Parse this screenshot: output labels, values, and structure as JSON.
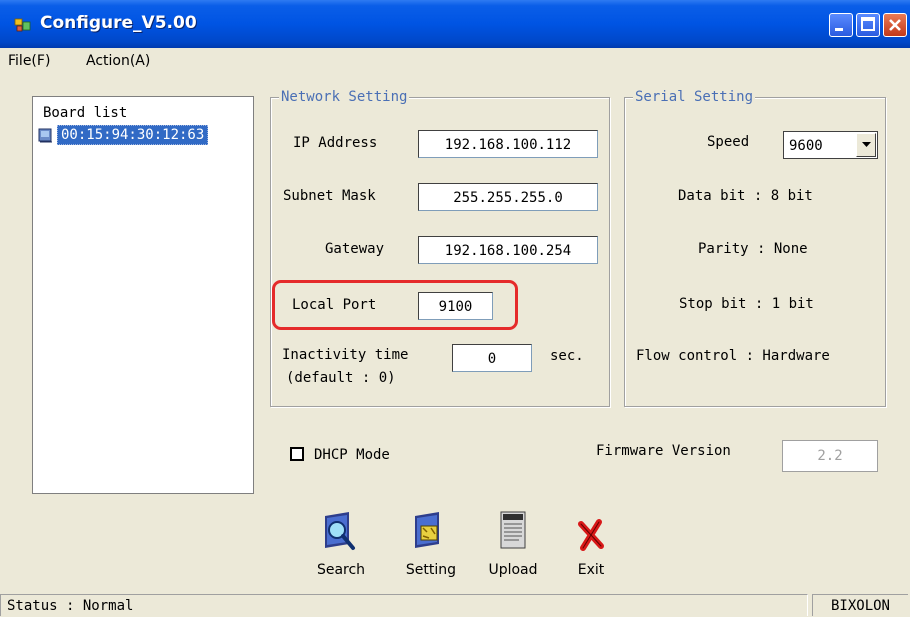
{
  "window": {
    "title": "Configure_V5.00"
  },
  "menu": {
    "file": "File(F)",
    "action": "Action(A)"
  },
  "board_list": {
    "header": "Board list",
    "items": [
      "00:15:94:30:12:63"
    ]
  },
  "network": {
    "legend": "Network Setting",
    "ip_label": "IP Address",
    "ip_value": "192.168.100.112",
    "subnet_label": "Subnet Mask",
    "subnet_value": "255.255.255.0",
    "gateway_label": "Gateway",
    "gateway_value": "192.168.100.254",
    "port_label": "Local Port",
    "port_value": "9100",
    "inactivity_label": "Inactivity time",
    "inactivity_default": "(default : 0)",
    "inactivity_value": "0",
    "inactivity_unit": "sec."
  },
  "serial": {
    "legend": "Serial Setting",
    "speed_label": "Speed",
    "speed_value": "9600",
    "data_bit": "Data bit : 8 bit",
    "parity": "Parity : None",
    "stop_bit": "Stop bit : 1 bit",
    "flow_control": "Flow control : Hardware"
  },
  "dhcp": {
    "label": "DHCP Mode",
    "checked": false
  },
  "firmware": {
    "label": "Firmware Version",
    "value": "2.2"
  },
  "toolbar": {
    "search": "Search",
    "setting": "Setting",
    "upload": "Upload",
    "exit": "Exit"
  },
  "status": {
    "text": "Status : Normal",
    "brand": "BIXOLON"
  },
  "colors": {
    "titlebar": "#0054E3",
    "highlight": "#E52B2B",
    "selection": "#316AC5"
  }
}
